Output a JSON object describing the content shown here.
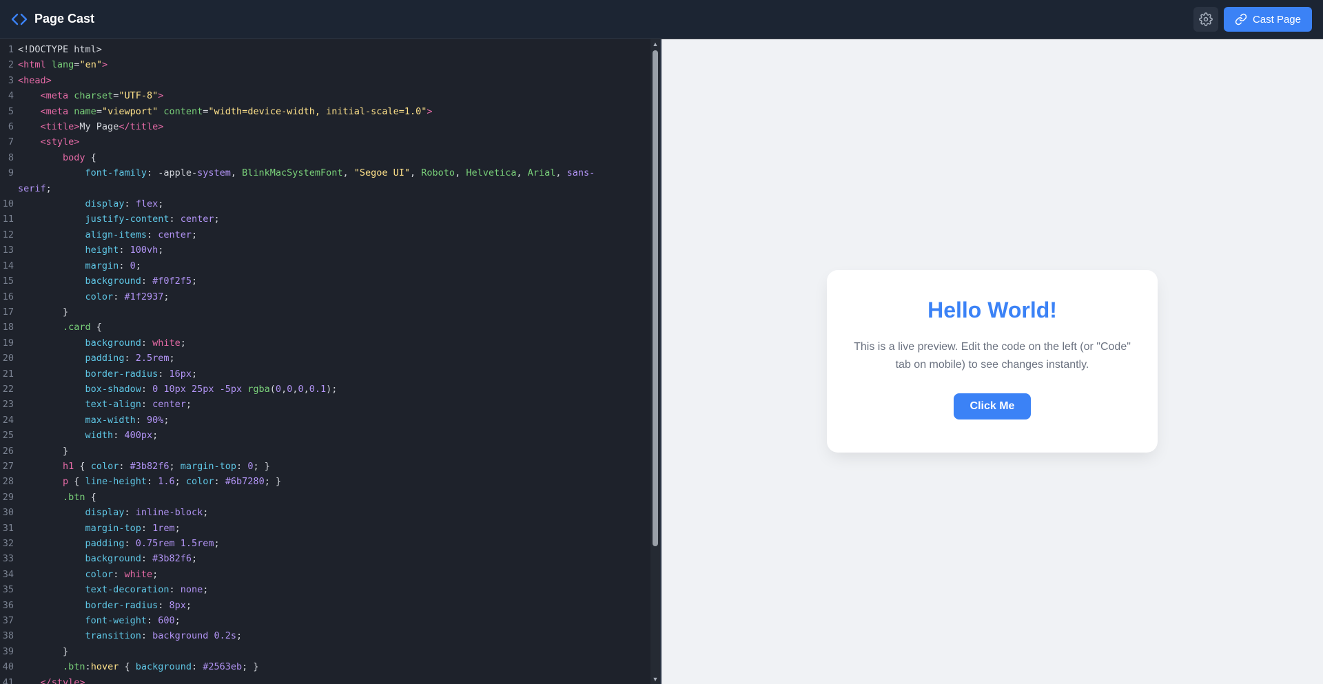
{
  "app": {
    "title": "Page Cast",
    "settings_icon": "gear-icon",
    "cast_button_label": "Cast Page",
    "cast_icon": "link-icon",
    "brand_icon": "code-brackets-icon",
    "accent_color": "#3b82f6"
  },
  "editor": {
    "lines": [
      {
        "n": "1",
        "tokens": [
          [
            "plain",
            "<!DOCTYPE html>"
          ]
        ]
      },
      {
        "n": "2",
        "tokens": [
          [
            "tag",
            "<html "
          ],
          [
            "attr",
            "lang"
          ],
          [
            "plain",
            "="
          ],
          [
            "str",
            "\"en\""
          ],
          [
            "tag",
            ">"
          ]
        ]
      },
      {
        "n": "3",
        "tokens": [
          [
            "tag",
            "<head>"
          ]
        ]
      },
      {
        "n": "4",
        "tokens": [
          [
            "plain",
            "    "
          ],
          [
            "tag",
            "<meta "
          ],
          [
            "attr",
            "charset"
          ],
          [
            "plain",
            "="
          ],
          [
            "str",
            "\"UTF-8\""
          ],
          [
            "tag",
            ">"
          ]
        ]
      },
      {
        "n": "5",
        "tokens": [
          [
            "plain",
            "    "
          ],
          [
            "tag",
            "<meta "
          ],
          [
            "attr",
            "name"
          ],
          [
            "plain",
            "="
          ],
          [
            "str",
            "\"viewport\""
          ],
          [
            "plain",
            " "
          ],
          [
            "attr",
            "content"
          ],
          [
            "plain",
            "="
          ],
          [
            "str",
            "\"width=device-width, initial-scale=1.0\""
          ],
          [
            "tag",
            ">"
          ]
        ]
      },
      {
        "n": "6",
        "tokens": [
          [
            "plain",
            "    "
          ],
          [
            "tag",
            "<title>"
          ],
          [
            "plain",
            "My Page"
          ],
          [
            "tag",
            "</title>"
          ]
        ]
      },
      {
        "n": "7",
        "tokens": [
          [
            "plain",
            "    "
          ],
          [
            "tag",
            "<style>"
          ]
        ]
      },
      {
        "n": "8",
        "tokens": [
          [
            "plain",
            "        "
          ],
          [
            "sel",
            "body"
          ],
          [
            "plain",
            " {"
          ]
        ]
      },
      {
        "n": "9",
        "tokens": [
          [
            "plain",
            "            "
          ],
          [
            "prop",
            "font-family"
          ],
          [
            "plain",
            ": -apple-"
          ],
          [
            "val",
            "system"
          ],
          [
            "plain",
            ", "
          ],
          [
            "cls",
            "BlinkMacSystemFont"
          ],
          [
            "plain",
            ", "
          ],
          [
            "str",
            "\"Segoe UI\""
          ],
          [
            "plain",
            ", "
          ],
          [
            "cls",
            "Roboto"
          ],
          [
            "plain",
            ", "
          ],
          [
            "cls",
            "Helvetica"
          ],
          [
            "plain",
            ", "
          ],
          [
            "cls",
            "Arial"
          ],
          [
            "plain",
            ", "
          ],
          [
            "val",
            "sans-"
          ]
        ]
      },
      {
        "n": "",
        "wrap": true,
        "tokens": [
          [
            "val",
            "serif"
          ],
          [
            "plain",
            ";"
          ]
        ]
      },
      {
        "n": "10",
        "tokens": [
          [
            "plain",
            "            "
          ],
          [
            "prop",
            "display"
          ],
          [
            "plain",
            ": "
          ],
          [
            "val",
            "flex"
          ],
          [
            "plain",
            ";"
          ]
        ]
      },
      {
        "n": "11",
        "tokens": [
          [
            "plain",
            "            "
          ],
          [
            "prop",
            "justify-content"
          ],
          [
            "plain",
            ": "
          ],
          [
            "val",
            "center"
          ],
          [
            "plain",
            ";"
          ]
        ]
      },
      {
        "n": "12",
        "tokens": [
          [
            "plain",
            "            "
          ],
          [
            "prop",
            "align-items"
          ],
          [
            "plain",
            ": "
          ],
          [
            "val",
            "center"
          ],
          [
            "plain",
            ";"
          ]
        ]
      },
      {
        "n": "13",
        "tokens": [
          [
            "plain",
            "            "
          ],
          [
            "prop",
            "height"
          ],
          [
            "plain",
            ": "
          ],
          [
            "val",
            "100vh"
          ],
          [
            "plain",
            ";"
          ]
        ]
      },
      {
        "n": "14",
        "tokens": [
          [
            "plain",
            "            "
          ],
          [
            "prop",
            "margin"
          ],
          [
            "plain",
            ": "
          ],
          [
            "val",
            "0"
          ],
          [
            "plain",
            ";"
          ]
        ]
      },
      {
        "n": "15",
        "tokens": [
          [
            "plain",
            "            "
          ],
          [
            "prop",
            "background"
          ],
          [
            "plain",
            ": "
          ],
          [
            "val",
            "#f0f2f5"
          ],
          [
            "plain",
            ";"
          ]
        ]
      },
      {
        "n": "16",
        "tokens": [
          [
            "plain",
            "            "
          ],
          [
            "prop",
            "color"
          ],
          [
            "plain",
            ": "
          ],
          [
            "val",
            "#1f2937"
          ],
          [
            "plain",
            ";"
          ]
        ]
      },
      {
        "n": "17",
        "tokens": [
          [
            "plain",
            "        }"
          ]
        ]
      },
      {
        "n": "18",
        "tokens": [
          [
            "plain",
            "        "
          ],
          [
            "cls",
            ".card"
          ],
          [
            "plain",
            " {"
          ]
        ]
      },
      {
        "n": "19",
        "tokens": [
          [
            "plain",
            "            "
          ],
          [
            "prop",
            "background"
          ],
          [
            "plain",
            ": "
          ],
          [
            "sel",
            "white"
          ],
          [
            "plain",
            ";"
          ]
        ]
      },
      {
        "n": "20",
        "tokens": [
          [
            "plain",
            "            "
          ],
          [
            "prop",
            "padding"
          ],
          [
            "plain",
            ": "
          ],
          [
            "val",
            "2.5rem"
          ],
          [
            "plain",
            ";"
          ]
        ]
      },
      {
        "n": "21",
        "tokens": [
          [
            "plain",
            "            "
          ],
          [
            "prop",
            "border-radius"
          ],
          [
            "plain",
            ": "
          ],
          [
            "val",
            "16px"
          ],
          [
            "plain",
            ";"
          ]
        ]
      },
      {
        "n": "22",
        "tokens": [
          [
            "plain",
            "            "
          ],
          [
            "prop",
            "box-shadow"
          ],
          [
            "plain",
            ": "
          ],
          [
            "val",
            "0 10px 25px -5px "
          ],
          [
            "cls",
            "rgba"
          ],
          [
            "plain",
            "("
          ],
          [
            "val",
            "0"
          ],
          [
            "plain",
            ","
          ],
          [
            "val",
            "0"
          ],
          [
            "plain",
            ","
          ],
          [
            "val",
            "0"
          ],
          [
            "plain",
            ","
          ],
          [
            "val",
            "0.1"
          ],
          [
            "plain",
            ");"
          ]
        ]
      },
      {
        "n": "23",
        "tokens": [
          [
            "plain",
            "            "
          ],
          [
            "prop",
            "text-align"
          ],
          [
            "plain",
            ": "
          ],
          [
            "val",
            "center"
          ],
          [
            "plain",
            ";"
          ]
        ]
      },
      {
        "n": "24",
        "tokens": [
          [
            "plain",
            "            "
          ],
          [
            "prop",
            "max-width"
          ],
          [
            "plain",
            ": "
          ],
          [
            "val",
            "90%"
          ],
          [
            "plain",
            ";"
          ]
        ]
      },
      {
        "n": "25",
        "tokens": [
          [
            "plain",
            "            "
          ],
          [
            "prop",
            "width"
          ],
          [
            "plain",
            ": "
          ],
          [
            "val",
            "400px"
          ],
          [
            "plain",
            ";"
          ]
        ]
      },
      {
        "n": "26",
        "tokens": [
          [
            "plain",
            "        }"
          ]
        ]
      },
      {
        "n": "27",
        "tokens": [
          [
            "plain",
            "        "
          ],
          [
            "sel",
            "h1"
          ],
          [
            "plain",
            " { "
          ],
          [
            "prop",
            "color"
          ],
          [
            "plain",
            ": "
          ],
          [
            "val",
            "#3b82f6"
          ],
          [
            "plain",
            "; "
          ],
          [
            "prop",
            "margin-top"
          ],
          [
            "plain",
            ": "
          ],
          [
            "val",
            "0"
          ],
          [
            "plain",
            "; }"
          ]
        ]
      },
      {
        "n": "28",
        "tokens": [
          [
            "plain",
            "        "
          ],
          [
            "sel",
            "p"
          ],
          [
            "plain",
            " { "
          ],
          [
            "prop",
            "line-height"
          ],
          [
            "plain",
            ": "
          ],
          [
            "val",
            "1.6"
          ],
          [
            "plain",
            "; "
          ],
          [
            "prop",
            "color"
          ],
          [
            "plain",
            ": "
          ],
          [
            "val",
            "#6b7280"
          ],
          [
            "plain",
            "; }"
          ]
        ]
      },
      {
        "n": "29",
        "tokens": [
          [
            "plain",
            "        "
          ],
          [
            "cls",
            ".btn"
          ],
          [
            "plain",
            " {"
          ]
        ]
      },
      {
        "n": "30",
        "tokens": [
          [
            "plain",
            "            "
          ],
          [
            "prop",
            "display"
          ],
          [
            "plain",
            ": "
          ],
          [
            "val",
            "inline-block"
          ],
          [
            "plain",
            ";"
          ]
        ]
      },
      {
        "n": "31",
        "tokens": [
          [
            "plain",
            "            "
          ],
          [
            "prop",
            "margin-top"
          ],
          [
            "plain",
            ": "
          ],
          [
            "val",
            "1rem"
          ],
          [
            "plain",
            ";"
          ]
        ]
      },
      {
        "n": "32",
        "tokens": [
          [
            "plain",
            "            "
          ],
          [
            "prop",
            "padding"
          ],
          [
            "plain",
            ": "
          ],
          [
            "val",
            "0.75rem 1.5rem"
          ],
          [
            "plain",
            ";"
          ]
        ]
      },
      {
        "n": "33",
        "tokens": [
          [
            "plain",
            "            "
          ],
          [
            "prop",
            "background"
          ],
          [
            "plain",
            ": "
          ],
          [
            "val",
            "#3b82f6"
          ],
          [
            "plain",
            ";"
          ]
        ]
      },
      {
        "n": "34",
        "tokens": [
          [
            "plain",
            "            "
          ],
          [
            "prop",
            "color"
          ],
          [
            "plain",
            ": "
          ],
          [
            "sel",
            "white"
          ],
          [
            "plain",
            ";"
          ]
        ]
      },
      {
        "n": "35",
        "tokens": [
          [
            "plain",
            "            "
          ],
          [
            "prop",
            "text-decoration"
          ],
          [
            "plain",
            ": "
          ],
          [
            "val",
            "none"
          ],
          [
            "plain",
            ";"
          ]
        ]
      },
      {
        "n": "36",
        "tokens": [
          [
            "plain",
            "            "
          ],
          [
            "prop",
            "border-radius"
          ],
          [
            "plain",
            ": "
          ],
          [
            "val",
            "8px"
          ],
          [
            "plain",
            ";"
          ]
        ]
      },
      {
        "n": "37",
        "tokens": [
          [
            "plain",
            "            "
          ],
          [
            "prop",
            "font-weight"
          ],
          [
            "plain",
            ": "
          ],
          [
            "val",
            "600"
          ],
          [
            "plain",
            ";"
          ]
        ]
      },
      {
        "n": "38",
        "tokens": [
          [
            "plain",
            "            "
          ],
          [
            "prop",
            "transition"
          ],
          [
            "plain",
            ": "
          ],
          [
            "val",
            "background 0.2s"
          ],
          [
            "plain",
            ";"
          ]
        ]
      },
      {
        "n": "39",
        "tokens": [
          [
            "plain",
            "        }"
          ]
        ]
      },
      {
        "n": "40",
        "tokens": [
          [
            "plain",
            "        "
          ],
          [
            "cls",
            ".btn"
          ],
          [
            "plain",
            ":"
          ],
          [
            "str",
            "hover"
          ],
          [
            "plain",
            " { "
          ],
          [
            "prop",
            "background"
          ],
          [
            "plain",
            ": "
          ],
          [
            "val",
            "#2563eb"
          ],
          [
            "plain",
            "; }"
          ]
        ]
      },
      {
        "n": "41",
        "tokens": [
          [
            "plain",
            "    "
          ],
          [
            "tag",
            "</style>"
          ]
        ]
      }
    ]
  },
  "preview": {
    "heading": "Hello World!",
    "paragraph": "This is a live preview. Edit the code on the left (or \"Code\" tab on mobile) to see changes instantly.",
    "button_label": "Click Me",
    "background": "#f0f2f5"
  }
}
